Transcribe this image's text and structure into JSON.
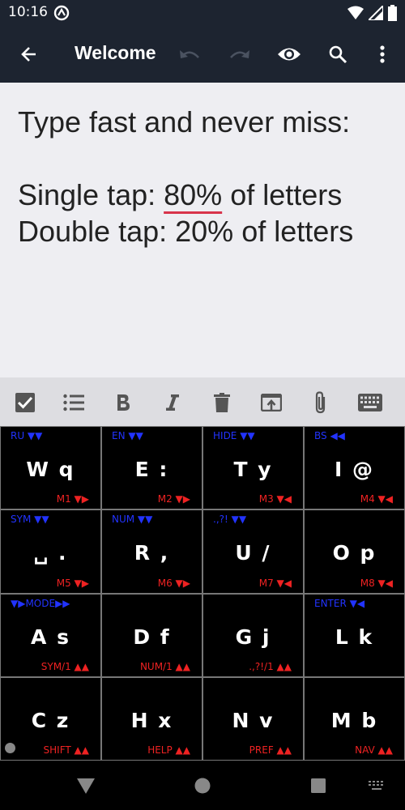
{
  "status": {
    "time": "10:16"
  },
  "appbar": {
    "title": "Welcome"
  },
  "editor": {
    "line1": "Type fast and never miss:",
    "line3_pre": "Single tap: ",
    "line3_mis": "80%",
    "line3_post": " of letters",
    "line4": "Double tap: 20% of letters"
  },
  "keyboard": {
    "keys": [
      {
        "tl": "RU ▼▼",
        "main": "W q",
        "br": "M1 ▼▶"
      },
      {
        "tl": "EN ▼▼",
        "main": "E :",
        "br": "M2 ▼▶"
      },
      {
        "tl": "HIDE ▼▼",
        "main": "T y",
        "br": "M3 ▼◀"
      },
      {
        "tl": "BS ◀◀",
        "main": "I @",
        "br": "M4 ▼◀"
      },
      {
        "tl": "SYM ▼▼",
        "main": "␣ .",
        "br": "M5 ▼▶"
      },
      {
        "tl": "NUM ▼▼",
        "main": "R ,",
        "br": "M6 ▼▶"
      },
      {
        "tl": ".,?! ▼▼",
        "main": "U /",
        "br": "M7 ▼◀"
      },
      {
        "tl": "",
        "main": "O p",
        "br": "M8 ▼◀"
      },
      {
        "tl": "▼▶MODE▶▶",
        "main": "A s",
        "br": "SYM/1 ▲▲"
      },
      {
        "tl": "",
        "main": "D f",
        "br": "NUM/1 ▲▲"
      },
      {
        "tl": "",
        "main": "G j",
        "br": ".,?!/1 ▲▲"
      },
      {
        "tl": "ENTER ▼◀",
        "main": "L k",
        "br": ""
      },
      {
        "tl": "",
        "main": "C z",
        "br": "SHIFT ▲▲"
      },
      {
        "tl": "",
        "main": "H x",
        "br": "HELP ▲▲"
      },
      {
        "tl": "",
        "main": "N v",
        "br": "PREF ▲▲"
      },
      {
        "tl": "",
        "main": "M b",
        "br": "NAV ▲▲"
      }
    ]
  },
  "colors": {
    "appbar": "#1d2430",
    "editor_bg": "#eeeef2",
    "hint_blue": "#2233ff",
    "hint_red": "#ee2222",
    "misspell": "#d8334a"
  }
}
